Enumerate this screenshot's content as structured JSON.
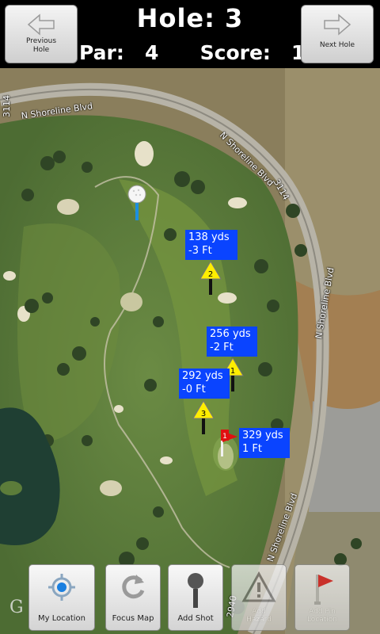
{
  "header": {
    "prev_label_1": "Previous",
    "prev_label_2": "Hole",
    "next_label": "Next Hole",
    "hole_label": "Hole:",
    "hole_number": "3",
    "par_label": "Par:",
    "par_value": "4",
    "score_label": "Score:",
    "score_value": "1"
  },
  "map": {
    "road_labels": [
      "N Shoreline Blvd",
      "N Shoreline Blvd",
      "N Shoreline Blvd",
      "N Shoreline Blvd",
      "3114",
      "3114",
      "2940"
    ],
    "shots": [
      {
        "number": "2",
        "yards": "138 yds",
        "elevation": "-3 Ft"
      },
      {
        "number": "1",
        "yards": "256 yds",
        "elevation": "-2 Ft"
      },
      {
        "number": "3",
        "yards": "292 yds",
        "elevation": "-0 Ft"
      },
      {
        "number": "1",
        "yards": "329 yds",
        "elevation": "1 Ft"
      }
    ],
    "pin_number": "1",
    "watermark": "G"
  },
  "toolbar": {
    "my_location": "My Location",
    "focus_map": "Focus Map",
    "add_shot": "Add Shot",
    "add_hazard_1": "Add",
    "add_hazard_2": "Hazard",
    "add_pin_1": "Add Pin",
    "add_pin_2": "Location"
  },
  "colors": {
    "distance_box": "#0a44ff",
    "marker_yellow": "#ffee00",
    "pin_flag": "#e01010",
    "fairway": "#5a7a3a"
  }
}
